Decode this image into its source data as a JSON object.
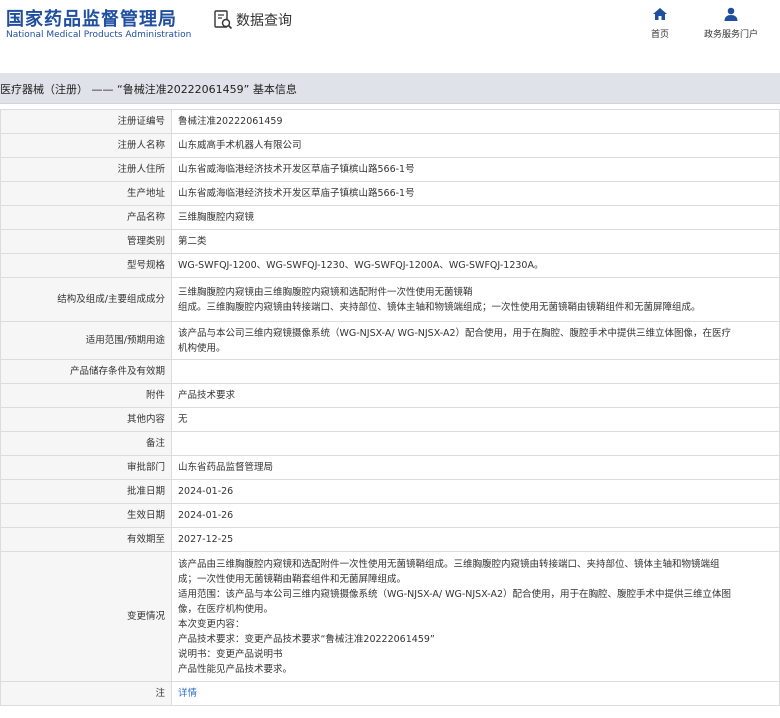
{
  "header": {
    "logo_cn": "国家药品监督管理局",
    "logo_en": "National Medical Products Administration",
    "query_label": "数据查询",
    "query_icon": "search-document-icon",
    "nav": [
      {
        "label": "首页",
        "icon": "home-icon"
      },
      {
        "label": "政务服务门户",
        "icon": "user-icon"
      }
    ]
  },
  "title": "医疗器械（注册） —— “鲁械注准20222061459” 基本信息",
  "rows": [
    {
      "label": "注册证编号",
      "value": "鲁械注准20222061459"
    },
    {
      "label": "注册人名称",
      "value": "山东威高手术机器人有限公司"
    },
    {
      "label": "注册人住所",
      "value": "山东省威海临港经济技术开发区草庙子镇槟山路566-1号"
    },
    {
      "label": "生产地址",
      "value": "山东省威海临港经济技术开发区草庙子镇槟山路566-1号"
    },
    {
      "label": "产品名称",
      "value": "三维胸腹腔内窥镜"
    },
    {
      "label": "管理类别",
      "value": "第二类"
    },
    {
      "label": "型号规格",
      "value": "WG-SWFQJ-1200、WG-SWFQJ-1230、WG-SWFQJ-1200A、WG-SWFQJ-1230A。"
    },
    {
      "label": "结构及组成/主要组成成分",
      "lines": [
        "三维胸腹腔内窥镜由三维胸腹腔内窥镜和选配附件一次性使用无菌镜鞘",
        "组成。三维胸腹腔内窥镜由转接端口、夹持部位、镜体主轴和物镜端组成；一次性使用无菌镜鞘由镜鞘组件和无菌屏障组成。"
      ]
    },
    {
      "label": "适用范围/预期用途",
      "lines": [
        "该产品与本公司三维内窥镜摄像系统（WG-NJSX-A/ WG-NJSX-A2）配合使用，用于在胸腔、腹腔手术中提供三维立体图像，在医疗",
        "机构使用。"
      ]
    },
    {
      "label": "产品储存条件及有效期",
      "value": ""
    },
    {
      "label": "附件",
      "value": "产品技术要求"
    },
    {
      "label": "其他内容",
      "value": "无"
    },
    {
      "label": "备注",
      "value": ""
    },
    {
      "label": "审批部门",
      "value": "山东省药品监督管理局"
    },
    {
      "label": "批准日期",
      "value": "2024-01-26"
    },
    {
      "label": "生效日期",
      "value": "2024-01-26"
    },
    {
      "label": "有效期至",
      "value": "2027-12-25"
    },
    {
      "label": "变更情况",
      "lines": [
        "该产品由三维胸腹腔内窥镜和选配附件一次性使用无菌镜鞘组成。三维胸腹腔内窥镜由转接端口、夹持部位、镜体主轴和物镜端组",
        "成；一次性使用无菌镜鞘由鞘套组件和无菌屏障组成。",
        "适用范围：该产品与本公司三维内窥镜摄像系统（WG-NJSX-A/ WG-NJSX-A2）配合使用，用于在胸腔、腹腔手术中提供三维立体图",
        "像，在医疗机构使用。",
        "本次变更内容：",
        "产品技术要求：变更产品技术要求“鲁械注准20222061459”",
        "说明书：变更产品说明书",
        "产品性能见产品技术要求。"
      ]
    },
    {
      "label": "注",
      "value": "详情",
      "link": true
    }
  ]
}
